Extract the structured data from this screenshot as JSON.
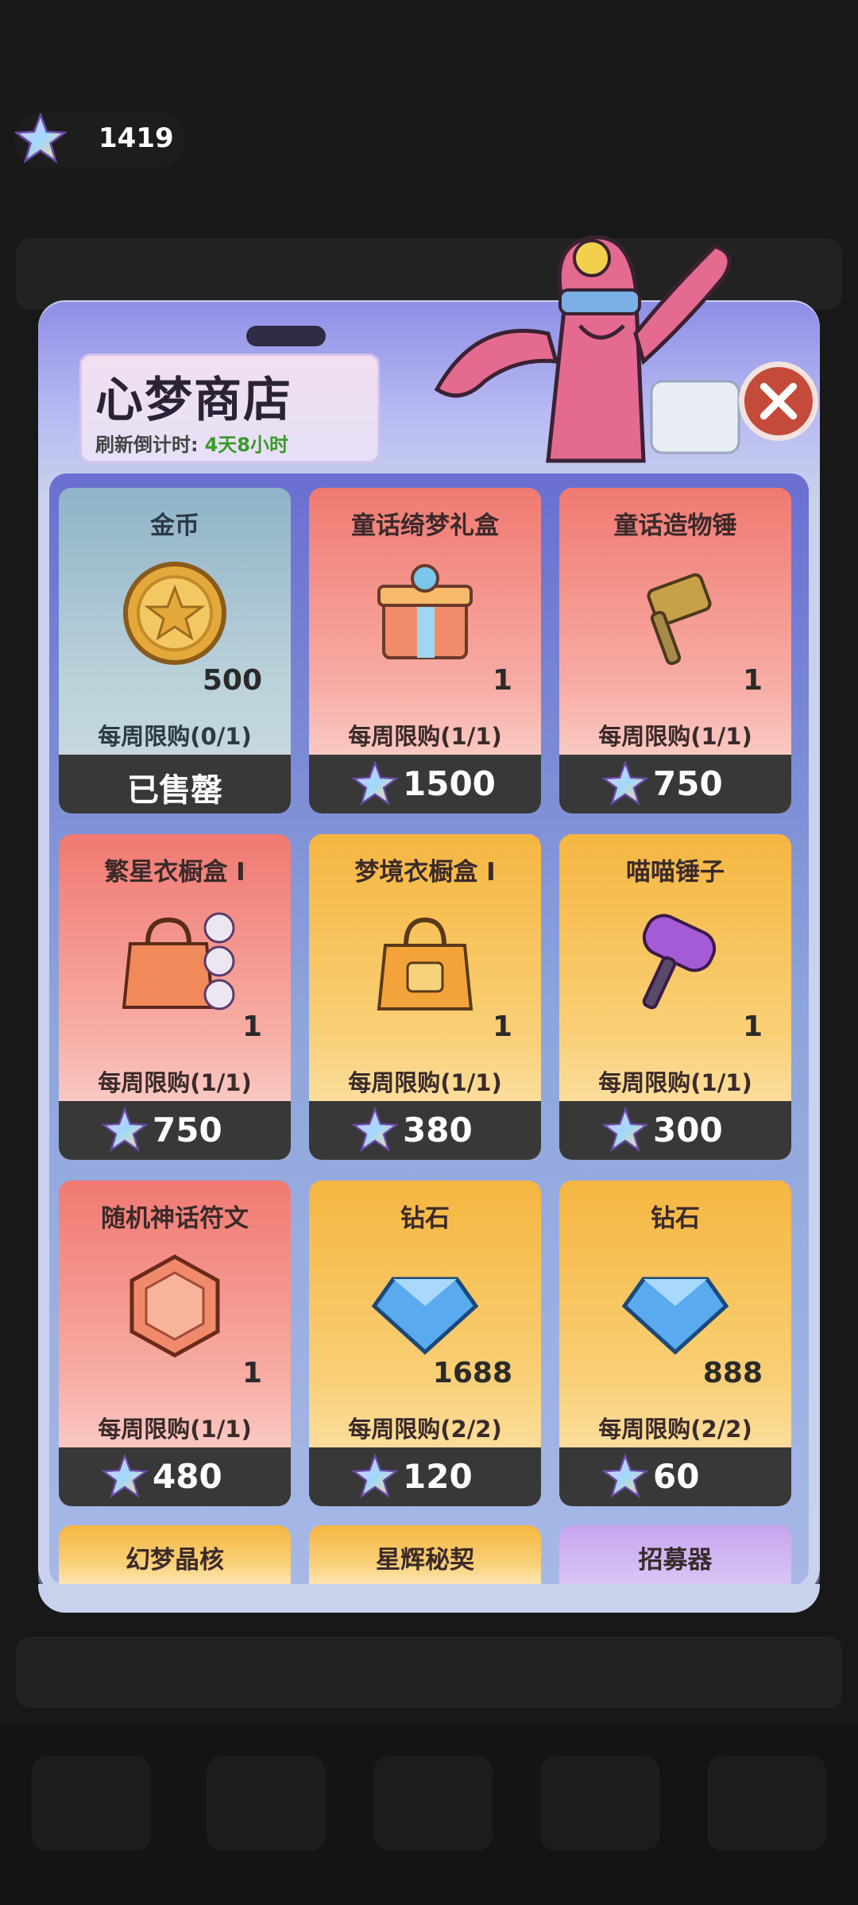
{
  "currency": {
    "icon": "star-crystal-icon",
    "amount": "1419"
  },
  "shop": {
    "title": "心梦商店",
    "refresh_label": "刷新倒计时:",
    "refresh_time": "4天8小时",
    "colors": {
      "panel": "#c9d2ec",
      "price_bar": "#383838",
      "timer": "#3a9a2a"
    },
    "items": [
      {
        "name": "金币",
        "icon": "gold-coin-icon",
        "qty": "500",
        "limit": "每周限购(0/1)",
        "price": "",
        "sold": "已售罄",
        "theme": "blue"
      },
      {
        "name": "童话绮梦礼盒",
        "icon": "gift-box-icon",
        "qty": "1",
        "limit": "每周限购(1/1)",
        "price": "1500",
        "theme": "red"
      },
      {
        "name": "童话造物锤",
        "icon": "hammer-icon",
        "qty": "1",
        "limit": "每周限购(1/1)",
        "price": "750",
        "theme": "red"
      },
      {
        "name": "繁星衣橱盒 I",
        "icon": "wardrobe-bag-icon",
        "qty": "1",
        "limit": "每周限购(1/1)",
        "price": "750",
        "theme": "red"
      },
      {
        "name": "梦境衣橱盒 I",
        "icon": "wardrobe-bag-icon",
        "qty": "1",
        "limit": "每周限购(1/1)",
        "price": "380",
        "theme": "gold"
      },
      {
        "name": "喵喵锤子",
        "icon": "cat-hammer-icon",
        "qty": "1",
        "limit": "每周限购(1/1)",
        "price": "300",
        "theme": "gold"
      },
      {
        "name": "随机神话符文",
        "icon": "rune-icon",
        "qty": "1",
        "limit": "每周限购(1/1)",
        "price": "480",
        "theme": "red"
      },
      {
        "name": "钻石",
        "icon": "diamond-icon",
        "qty": "1688",
        "limit": "每周限购(2/2)",
        "price": "120",
        "theme": "gold"
      },
      {
        "name": "钻石",
        "icon": "diamond-icon",
        "qty": "888",
        "limit": "每周限购(2/2)",
        "price": "60",
        "theme": "gold"
      }
    ],
    "partial_items": [
      {
        "name": "幻梦晶核",
        "theme": "gold"
      },
      {
        "name": "星辉秘契",
        "theme": "gold"
      },
      {
        "name": "招募器",
        "theme": "purple"
      }
    ]
  }
}
